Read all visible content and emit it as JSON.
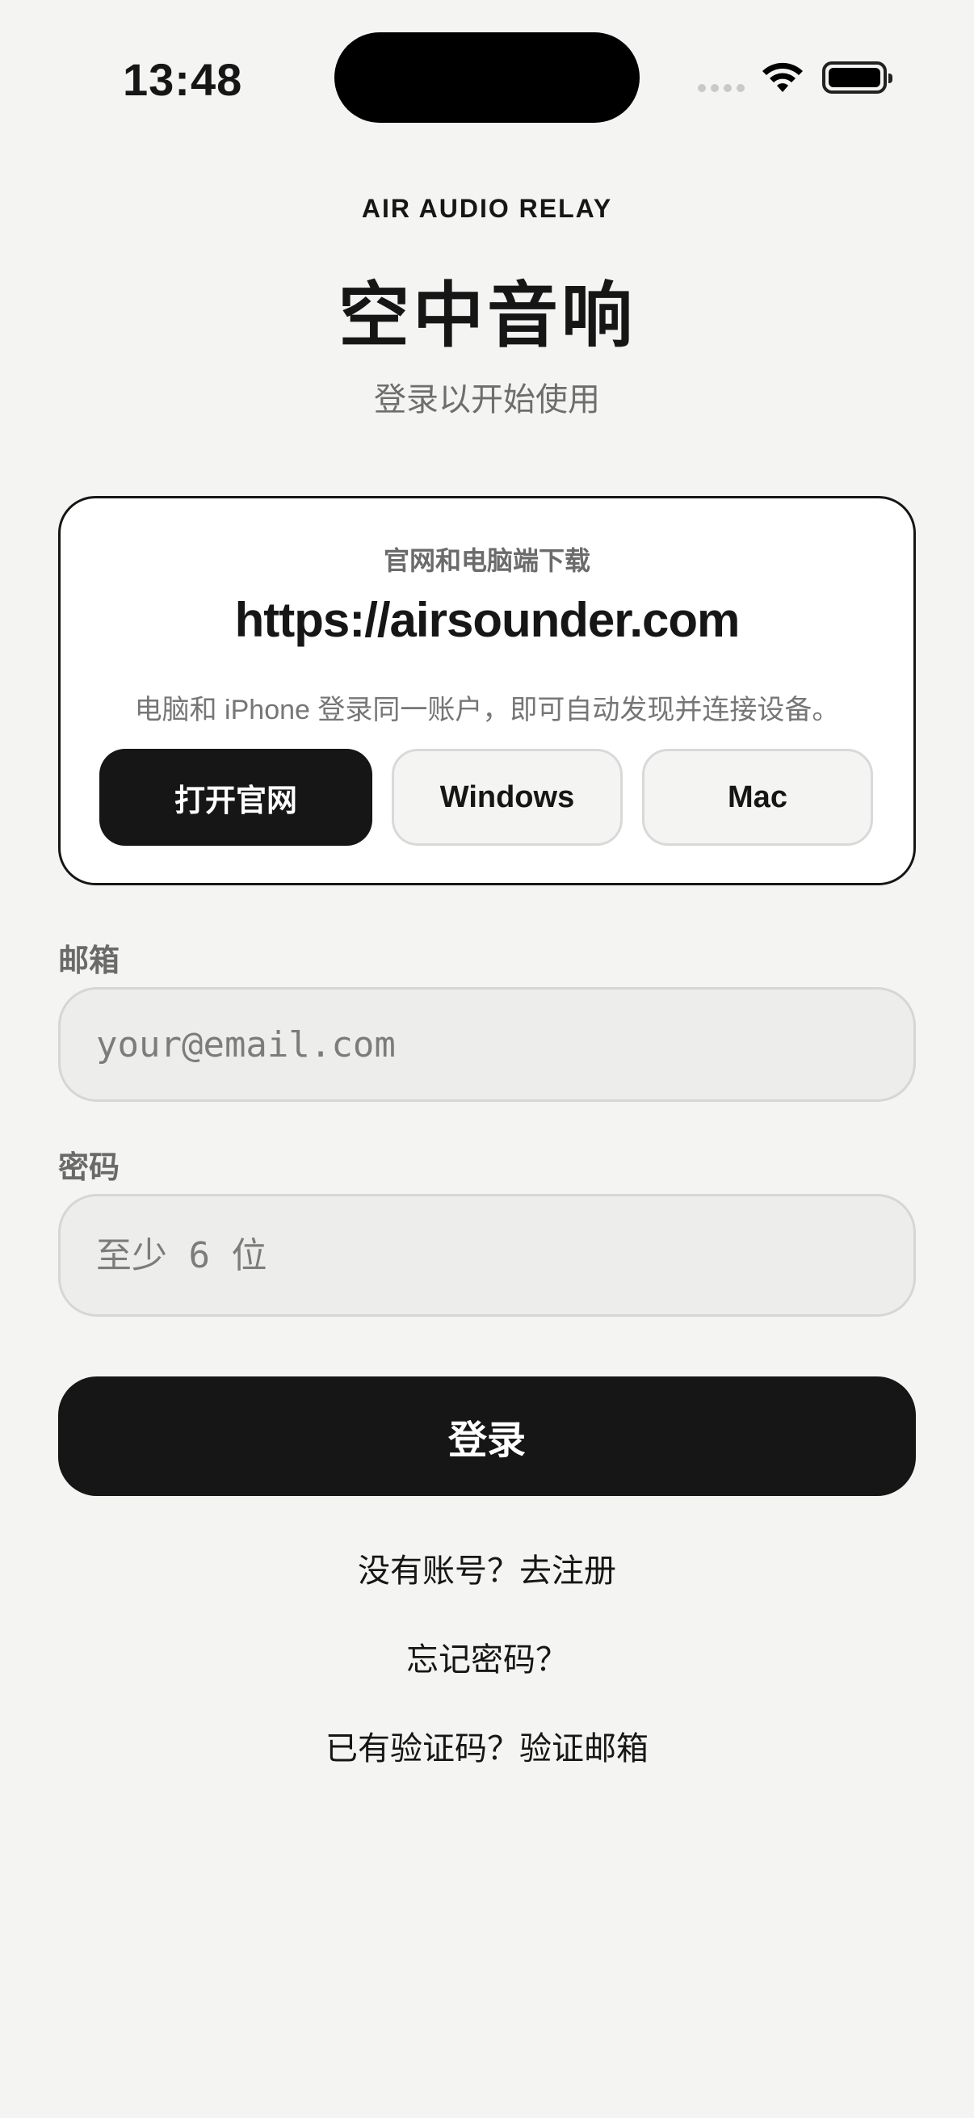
{
  "status_bar": {
    "time": "13:48",
    "icons": [
      "cellular-signal-icon",
      "wifi-icon",
      "battery-icon"
    ]
  },
  "header": {
    "brand": "AIR AUDIO RELAY",
    "title": "空中音响",
    "subtitle": "登录以开始使用"
  },
  "download_card": {
    "label": "官网和电脑端下载",
    "url": "https://airsounder.com",
    "description": "电脑和 iPhone 登录同一账户，即可自动发现并连接设备。",
    "buttons": {
      "open_site": "打开官网",
      "windows": "Windows",
      "mac": "Mac"
    }
  },
  "form": {
    "email_label": "邮箱",
    "email_placeholder": "your@email.com",
    "email_value": "",
    "password_label": "密码",
    "password_placeholder": "至少 6 位",
    "password_value": "",
    "submit_label": "登录"
  },
  "links": {
    "register": "没有账号？去注册",
    "forgot_password": "忘记密码？",
    "verify_email": "已有验证码？验证邮箱"
  },
  "colors": {
    "background": "#f4f4f2",
    "primary": "#161616",
    "card": "#ffffff",
    "muted_text": "#6e6e6e"
  }
}
